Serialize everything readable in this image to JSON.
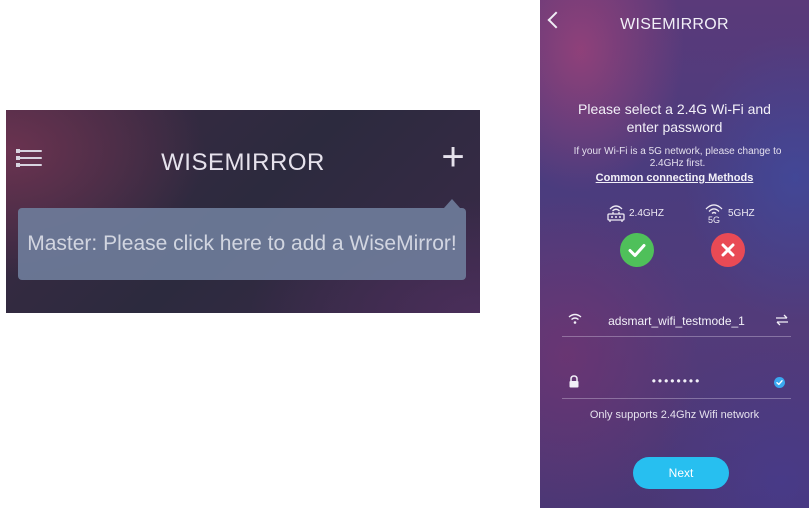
{
  "left_screen": {
    "title": "WISEMIRROR",
    "menu_icon": "hamburger-menu-icon",
    "add_icon": "plus-icon",
    "tooltip": "Master: Please click here to add a WiseMirror!"
  },
  "right_screen": {
    "title": "WISEMIRROR",
    "back_icon": "chevron-left-icon",
    "heading": "Please select a 2.4G Wi-Fi and enter password",
    "hint": "If your Wi-Fi is a 5G network, please change to 2.4GHz first.",
    "link": "Common connecting Methods",
    "bands": [
      {
        "label": "2.4GHZ",
        "status": "supported"
      },
      {
        "label": "5GHZ",
        "icon_text": "5G",
        "status": "unsupported"
      }
    ],
    "wifi_name": "adsmart_wifi_testmode_1",
    "password_mask": "••••••••",
    "note": "Only supports 2.4Ghz Wifi network",
    "next_label": "Next",
    "colors": {
      "accent": "#27bff0",
      "ok": "#4fc05a",
      "error": "#e94a55"
    }
  }
}
